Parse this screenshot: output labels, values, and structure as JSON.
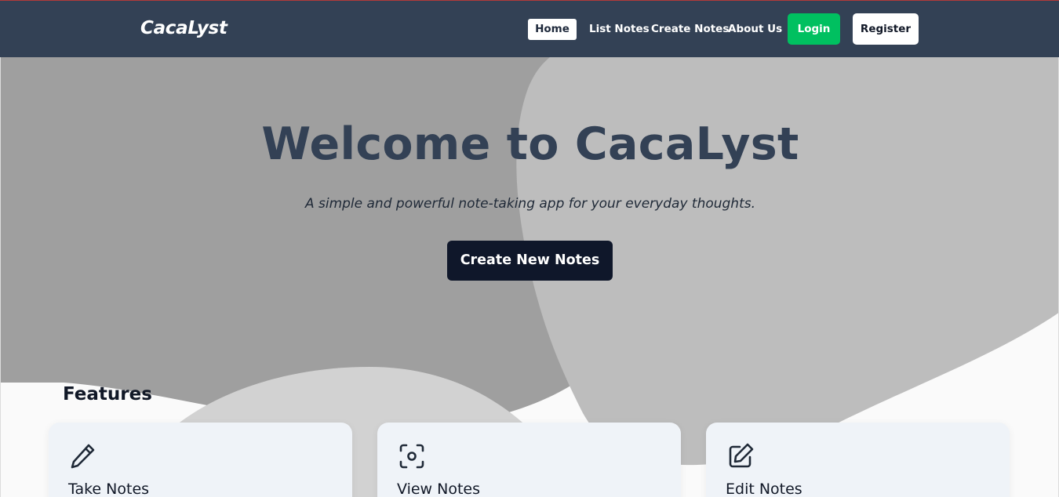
{
  "navbar": {
    "brand": "CacaLyst",
    "links": {
      "home": "Home",
      "list": "List Notes",
      "create": "Create Notes",
      "about": "About Us"
    },
    "login_label": "Login",
    "register_label": "Register",
    "colors": {
      "bar": "#334155",
      "login": "#00c060"
    }
  },
  "hero": {
    "title": "Welcome to CacaLyst",
    "subtitle": "A simple and powerful note-taking app for your everyday thoughts.",
    "cta_label": "Create New Notes"
  },
  "features": {
    "heading": "Features",
    "cards": [
      {
        "label": "Take Notes",
        "icon": "pencil-icon"
      },
      {
        "label": "View Notes",
        "icon": "scan-eye-icon"
      },
      {
        "label": "Edit Notes",
        "icon": "edit-square-icon"
      }
    ]
  }
}
